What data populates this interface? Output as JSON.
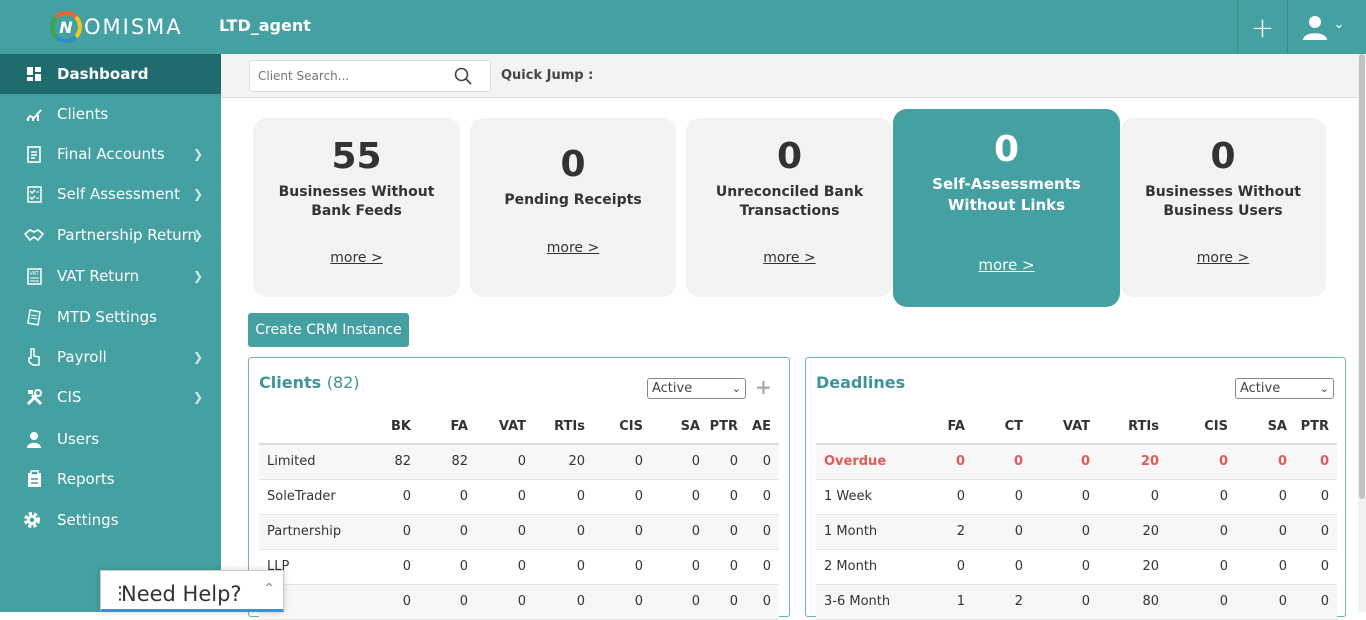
{
  "app": {
    "logo_letter": "N",
    "logo_text": "OMISMA",
    "agent": "LTD_agent",
    "accent": "#45a0a2"
  },
  "topbar": {
    "add_glyph": "+",
    "user_chevron": "⌄"
  },
  "sidebar": {
    "items": [
      {
        "label": "Dashboard",
        "icon": "dashboard-icon"
      },
      {
        "label": "Clients",
        "icon": "chart-icon"
      },
      {
        "label": "Final Accounts",
        "icon": "document-icon"
      },
      {
        "label": "Self Assessment",
        "icon": "checklist-icon"
      },
      {
        "label": "Partnership Return",
        "icon": "handshake-icon"
      },
      {
        "label": "VAT Return",
        "icon": "vat-icon"
      },
      {
        "label": "MTD Settings",
        "icon": "settings-doc-icon"
      },
      {
        "label": "Payroll",
        "icon": "payroll-icon"
      },
      {
        "label": "CIS",
        "icon": "tools-icon"
      },
      {
        "label": "Users",
        "icon": "user-icon"
      },
      {
        "label": "Reports",
        "icon": "clipboard-icon"
      },
      {
        "label": "Settings",
        "icon": "gear-icon"
      }
    ]
  },
  "search": {
    "placeholder": "Client Search...",
    "quick_jump": "Quick Jump :"
  },
  "cards": [
    {
      "value": "55",
      "label": "Businesses Without Bank Feeds",
      "more": "more >"
    },
    {
      "value": "0",
      "label": "Pending Receipts",
      "more": "more >"
    },
    {
      "value": "0",
      "label": "Unreconciled Bank Transactions",
      "more": "more >"
    },
    {
      "value": "0",
      "label": "Self-Assessments Without Links",
      "more": "more >"
    },
    {
      "value": "0",
      "label": "Businesses Without Business Users",
      "more": "more >"
    }
  ],
  "crm_button": "Create CRM Instance",
  "clients": {
    "title": "Clients",
    "count": "(82)",
    "filter": "Active",
    "add": "+",
    "columns": [
      "",
      "BK",
      "FA",
      "VAT",
      "RTIs",
      "CIS",
      "SA",
      "PTR",
      "AE"
    ],
    "rows": [
      [
        "Limited",
        "82",
        "82",
        "0",
        "20",
        "0",
        "0",
        "0",
        "0"
      ],
      [
        "SoleTrader",
        "0",
        "0",
        "0",
        "0",
        "0",
        "0",
        "0",
        "0"
      ],
      [
        "Partnership",
        "0",
        "0",
        "0",
        "0",
        "0",
        "0",
        "0",
        "0"
      ],
      [
        "LLP",
        "0",
        "0",
        "0",
        "0",
        "0",
        "0",
        "0",
        "0"
      ],
      [
        "",
        "0",
        "0",
        "0",
        "0",
        "0",
        "0",
        "0",
        "0"
      ]
    ]
  },
  "deadlines": {
    "title": "Deadlines",
    "filter": "Active",
    "columns": [
      "",
      "FA",
      "CT",
      "VAT",
      "RTIs",
      "CIS",
      "SA",
      "PTR"
    ],
    "rows": [
      [
        "Overdue",
        "0",
        "0",
        "0",
        "20",
        "0",
        "0",
        "0"
      ],
      [
        "1 Week",
        "0",
        "0",
        "0",
        "0",
        "0",
        "0",
        "0"
      ],
      [
        "1 Month",
        "2",
        "0",
        "0",
        "20",
        "0",
        "0",
        "0"
      ],
      [
        "2 Month",
        "0",
        "0",
        "0",
        "20",
        "0",
        "0",
        "0"
      ],
      [
        "3-6 Month",
        "1",
        "2",
        "0",
        "80",
        "0",
        "0",
        "0"
      ]
    ]
  },
  "help": {
    "label": "Need Help?",
    "dots": "⋮",
    "toggle": "⌃"
  }
}
